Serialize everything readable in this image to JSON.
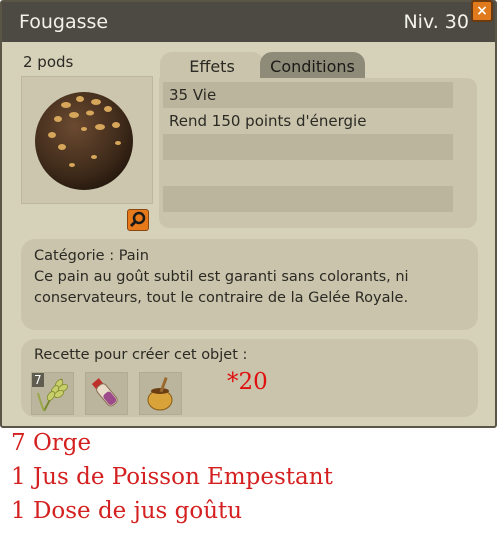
{
  "window": {
    "title": "Fougasse",
    "level": "Niv. 30",
    "close_label": "×"
  },
  "item": {
    "weight": "2 pods",
    "image": "fougasse-bread-icon"
  },
  "tabs": [
    {
      "label": "Effets",
      "active": true
    },
    {
      "label": "Conditions",
      "active": false
    }
  ],
  "effects": [
    "35 Vie",
    "Rend 150 points d'énergie",
    "",
    "",
    ""
  ],
  "description": {
    "category": "Catégorie : Pain",
    "text": "Ce pain au goût subtil est garanti sans colorants, ni conservateurs, tout le contraire de la Gelée Royale."
  },
  "recipe": {
    "label": "Recette pour créer cet objet :",
    "ingredients": [
      {
        "icon": "orge-wheat-icon",
        "qty": "7"
      },
      {
        "icon": "fish-juice-vial-icon",
        "qty": ""
      },
      {
        "icon": "juice-pot-icon",
        "qty": ""
      }
    ],
    "multiplier": "*20"
  },
  "notes": [
    "7 Orge",
    "1 Jus de Poisson Empestant",
    "1 Dose de jus goûtu"
  ],
  "colors": {
    "accent": "#e6791a",
    "note_red": "#d42020",
    "titlebar": "#4c4a42"
  }
}
